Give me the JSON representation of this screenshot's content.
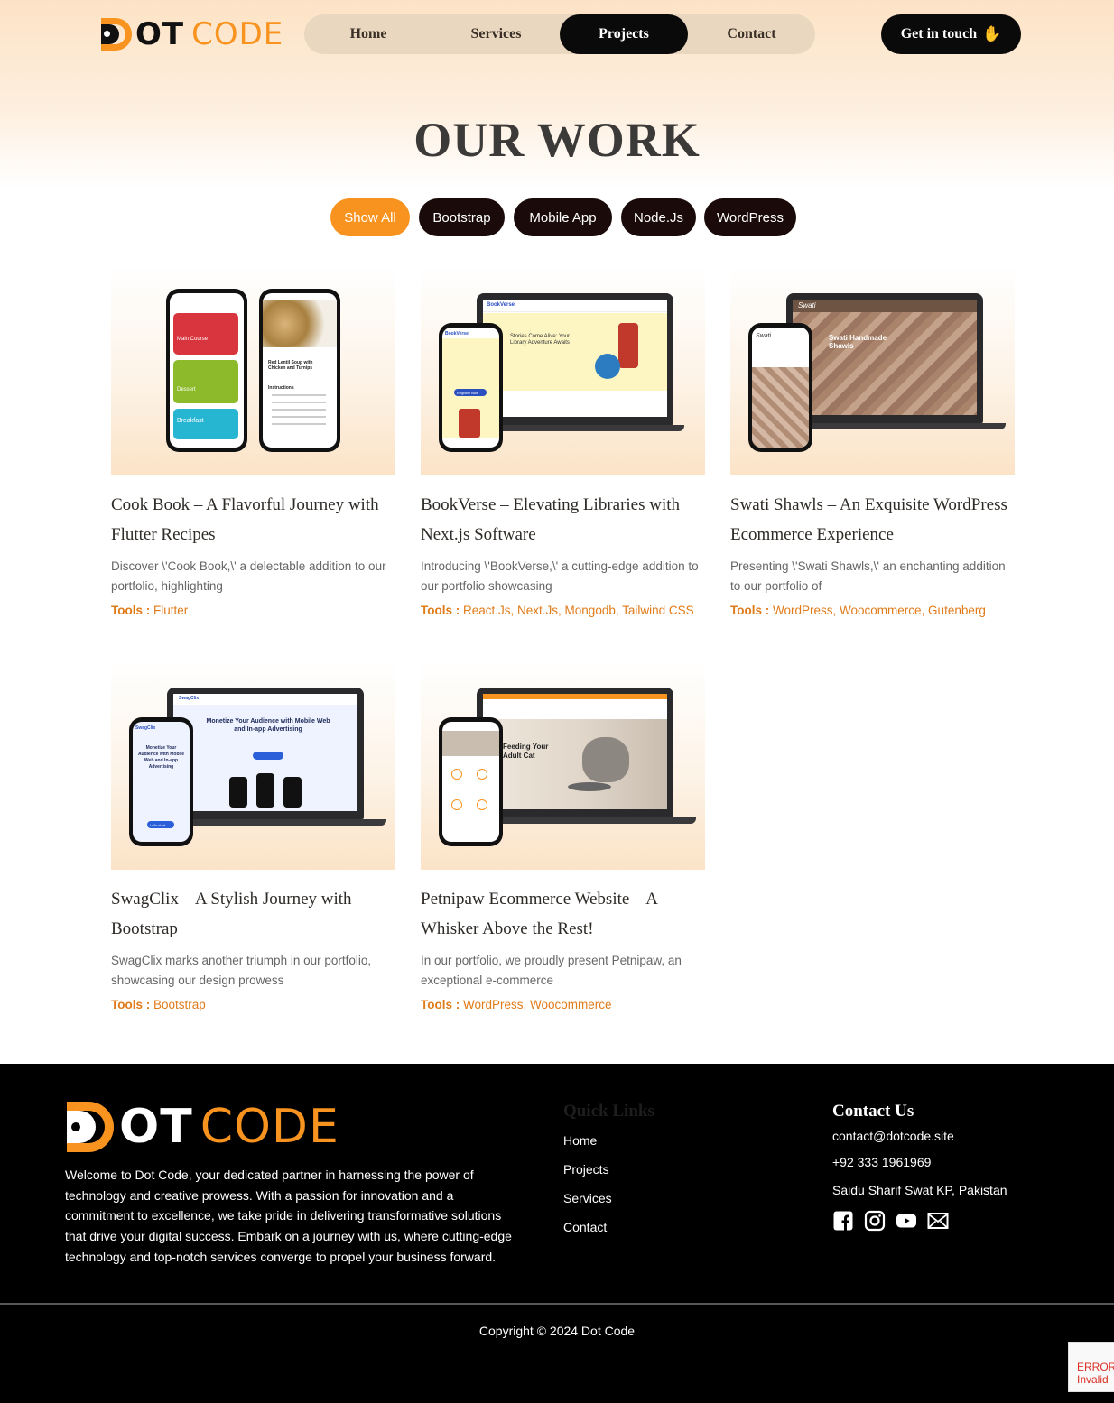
{
  "brand": {
    "logo_ot": "OT",
    "logo_code": "CODE",
    "accent_color": "#f7931e"
  },
  "nav": {
    "items": [
      {
        "label": "Home",
        "active": false
      },
      {
        "label": "Services",
        "active": false
      },
      {
        "label": "Projects",
        "active": true
      },
      {
        "label": "Contact",
        "active": false
      }
    ],
    "cta_label": "Get in touch",
    "cta_icon": "waving-hand-icon"
  },
  "page_title": "OUR WORK",
  "filters": [
    {
      "label": "Show All",
      "active": true
    },
    {
      "label": "Bootstrap",
      "active": false
    },
    {
      "label": "Mobile App",
      "active": false
    },
    {
      "label": "Node.Js",
      "active": false
    },
    {
      "label": "WordPress",
      "active": false
    }
  ],
  "projects": [
    {
      "title": "Cook Book – A Flavorful Journey with Flutter Recipes",
      "description": "Discover \\'Cook Book,\\' a delectable addition to our portfolio, highlighting",
      "tools_label": "Tools :",
      "tools": "Flutter",
      "thumb": {
        "phone1_items": [
          "Main Course",
          "Dessert",
          "Breakfast"
        ],
        "phone2_title": "Red Lentil Soup with Chicken and Turnips",
        "phone2_section": "Instructions"
      }
    },
    {
      "title": "BookVerse – Elevating Libraries with Next.js Software",
      "description": "Introducing \\'BookVerse,\\' a cutting-edge addition to our portfolio showcasing",
      "tools_label": "Tools :",
      "tools": "React.Js, Next.Js, Mongodb, Tailwind CSS",
      "thumb": {
        "brand": "BookVerse",
        "headline": "Stories Come Alive: Your Library Adventure Awaits",
        "cta": "Register Now"
      }
    },
    {
      "title": "Swati Shawls – An Exquisite WordPress Ecommerce Experience",
      "description": "Presenting \\'Swati Shawls,\\' an enchanting addition to our portfolio of",
      "tools_label": "Tools :",
      "tools": "WordPress, Woocommerce, Gutenberg",
      "thumb": {
        "brand": "Swati",
        "headline": "Swati Handmade Shawls"
      }
    },
    {
      "title": "SwagClix – A Stylish Journey with Bootstrap",
      "description": "SwagClix marks another triumph in our portfolio, showcasing our design prowess",
      "tools_label": "Tools :",
      "tools": "Bootstrap",
      "thumb": {
        "brand": "SwagClix",
        "headline": "Monetize Your Audience with Mobile Web and In-app Advertising",
        "cta": "Let's start"
      }
    },
    {
      "title": "Petnipaw Ecommerce Website – A Whisker Above the Rest!",
      "description": "In our portfolio, we proudly present Petnipaw, an exceptional e-commerce",
      "tools_label": "Tools :",
      "tools": "WordPress, Woocommerce",
      "thumb": {
        "headline": "Feeding Your Adult Cat"
      }
    }
  ],
  "footer": {
    "about": "Welcome to Dot Code, your dedicated partner in harnessing the power of technology and creative prowess. With a passion for innovation and a commitment to excellence, we take pride in delivering transformative solutions that drive your digital success. Embark on a journey with us, where cutting-edge technology and top-notch services converge to propel your business forward.",
    "quick_links_heading": "Quick Links",
    "quick_links": [
      "Home",
      "Projects",
      "Services",
      "Contact"
    ],
    "contact_heading": "Contact Us",
    "email": "contact@dotcode.site",
    "phone": "+92 333 1961969",
    "address": "Saidu Sharif Swat KP, Pakistan",
    "social_icons": [
      "facebook-icon",
      "instagram-icon",
      "youtube-icon",
      "mail-icon"
    ],
    "copyright": "Copyright © 2024 Dot Code"
  },
  "recaptcha": {
    "line1": "ERROR",
    "line2": "Invalid"
  }
}
